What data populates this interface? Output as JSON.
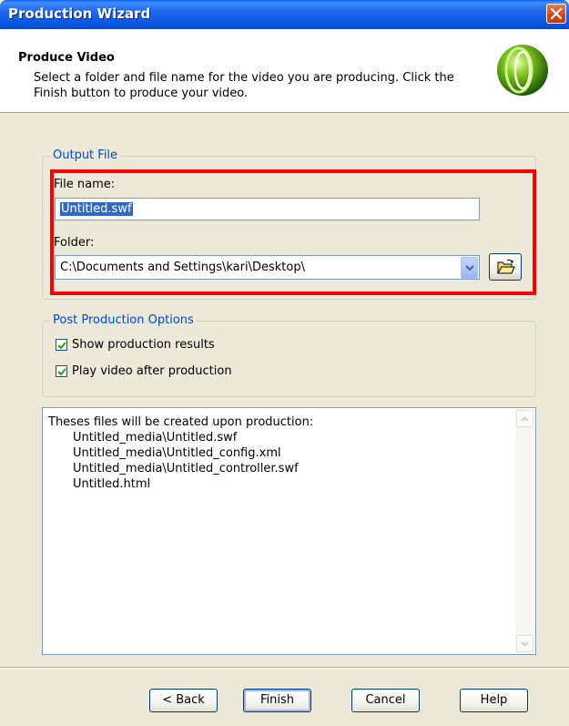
{
  "window": {
    "title": "Production Wizard"
  },
  "header": {
    "title": "Produce Video",
    "description": "Select a folder and file name for the video you are producing.  Click the Finish button to produce your video."
  },
  "output_file": {
    "group_label": "Output File",
    "file_name_label": "File name:",
    "file_name_value": "Untitled.swf",
    "folder_label": "Folder:",
    "folder_value": "C:\\Documents and Settings\\kari\\Desktop\\"
  },
  "post_production": {
    "group_label": "Post Production Options",
    "options": [
      {
        "label": "Show production results",
        "checked": true
      },
      {
        "label": "Play video after production",
        "checked": true
      }
    ]
  },
  "files_list": {
    "header": "Theses files will be created upon production:",
    "items": [
      "Untitled_media\\Untitled.swf",
      "Untitled_media\\Untitled_config.xml",
      "Untitled_media\\Untitled_controller.swf",
      "Untitled.html"
    ]
  },
  "buttons": {
    "back": "< Back",
    "finish": "Finish",
    "cancel": "Cancel",
    "help": "Help"
  },
  "colors": {
    "titlebar": "#0454E0",
    "face": "#ECE9D8",
    "group_label": "#0046D5",
    "highlight": "#FF0000"
  },
  "icons": [
    "close-icon",
    "app-logo-icon",
    "dropdown-arrow-icon",
    "open-folder-icon",
    "checkmark-icon",
    "scroll-up-icon",
    "scroll-down-icon"
  ]
}
